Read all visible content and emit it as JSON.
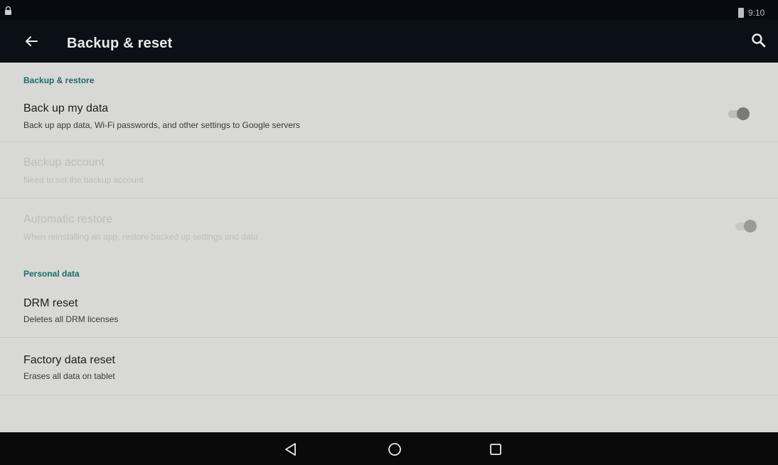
{
  "status_bar": {
    "time": "9:10",
    "icons": [
      "lock-icon",
      "battery-icon"
    ]
  },
  "app_bar": {
    "title": "Backup & reset",
    "icons": [
      "back-arrow-icon",
      "search-icon"
    ]
  },
  "sections": [
    {
      "header": "Backup & restore",
      "items": [
        {
          "title": "Back up my data",
          "summary": "Back up app data, Wi-Fi passwords, and other settings to Google servers",
          "enabled": true,
          "toggle": "off"
        },
        {
          "title": "Backup account",
          "summary": "Need to set the backup account",
          "enabled": false
        },
        {
          "title": "Automatic restore",
          "summary": "When reinstalling an app, restore backed up settings and data",
          "enabled": false,
          "toggle": "on"
        }
      ]
    },
    {
      "header": "Personal data",
      "items": [
        {
          "title": "DRM reset",
          "summary": "Deletes all DRM licenses",
          "enabled": true
        },
        {
          "title": "Factory data reset",
          "summary": "Erases all data on tablet",
          "enabled": true
        }
      ]
    }
  ],
  "nav_bar": {
    "icons": [
      "back-triangle-icon",
      "home-circle-icon",
      "recents-square-icon"
    ]
  },
  "colors": {
    "accent": "#1a6e66",
    "content_background": "#d8d8d6",
    "bar_background": "#0b1016"
  }
}
